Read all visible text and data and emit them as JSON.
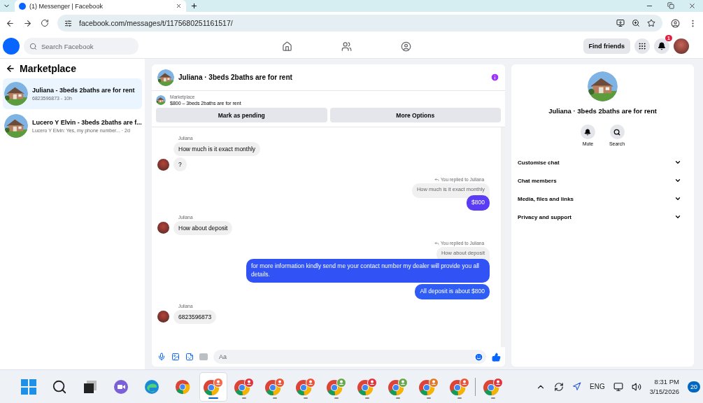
{
  "browser": {
    "tab_title": "(1) Messenger | Facebook",
    "url": "facebook.com/messages/t/1175680251161517/"
  },
  "topbar": {
    "search_placeholder": "Search Facebook",
    "find_friends": "Find friends",
    "notification_count": "1"
  },
  "sidebar": {
    "title": "Marketplace",
    "conversations": [
      {
        "name": "Juliana - 3beds 2baths are for rent",
        "preview": "6823596873 - 10h",
        "selected": true
      },
      {
        "name": "Lucero Y Elvin - 3beds 2baths are f...",
        "preview": "Lucero Y Elvin: Yes, my phone number... · 2d",
        "selected": false
      }
    ]
  },
  "chat": {
    "title": "Juliana · 3beds 2baths are for rent",
    "listing": {
      "label": "Marketplace",
      "title": "$800 – 3beds 2baths are for rent"
    },
    "buttons": [
      "Mark as pending",
      "More Options"
    ],
    "messages": [
      {
        "kind": "sender",
        "text": "Juliana"
      },
      {
        "kind": "incoming",
        "text": "How much is it exact monthly",
        "avatar": false
      },
      {
        "kind": "incoming",
        "text": "?",
        "avatar": true
      },
      {
        "kind": "reply_note",
        "text": "You replied to Juliana"
      },
      {
        "kind": "quoted",
        "text": "How much is it exact monthly"
      },
      {
        "kind": "outgoing",
        "text": "$800",
        "color": "#5b3cf5"
      },
      {
        "kind": "sender",
        "text": "Juliana"
      },
      {
        "kind": "incoming",
        "text": "How about deposit",
        "avatar": true
      },
      {
        "kind": "reply_note",
        "text": "You replied to Juliana"
      },
      {
        "kind": "quoted",
        "text": "How about deposit"
      },
      {
        "kind": "outgoing",
        "text": "for more information kindly send me your contact number my dealer will provide you all  details.",
        "color": "#3153f5"
      },
      {
        "kind": "outgoing",
        "text": "All deposit is about $800",
        "color": "#2f5cf5"
      },
      {
        "kind": "sender",
        "text": "Juliana"
      },
      {
        "kind": "incoming",
        "text": "6823596873",
        "avatar": true
      }
    ],
    "composer_placeholder": "Aa"
  },
  "details": {
    "title": "Juliana · 3beds 2baths are for rent",
    "actions": [
      {
        "kind": "mute",
        "label": "Mute"
      },
      {
        "kind": "search",
        "label": "Search"
      }
    ],
    "sections": [
      "Customise chat",
      "Chat members",
      "Media, files and links",
      "Privacy and support"
    ]
  },
  "taskbar": {
    "apps": [
      {
        "kind": "start",
        "active": false
      },
      {
        "kind": "search",
        "active": false
      },
      {
        "kind": "taskview",
        "active": false
      },
      {
        "kind": "meet",
        "active": false
      },
      {
        "kind": "edge",
        "active": false
      },
      {
        "kind": "chrome",
        "active": false
      },
      {
        "kind": "profile",
        "active": true,
        "color": "#f26b4a"
      },
      {
        "kind": "profile",
        "active": false,
        "color": "#e0343e"
      },
      {
        "kind": "profile",
        "active": false,
        "color": "#e8553a"
      },
      {
        "kind": "profile",
        "active": false,
        "color": "#e8553a"
      },
      {
        "kind": "profile",
        "active": false,
        "color": "#6aa84f"
      },
      {
        "kind": "profile",
        "active": false,
        "color": "#e0343e"
      },
      {
        "kind": "profile",
        "active": false,
        "color": "#6aa84f"
      },
      {
        "kind": "profile",
        "active": false,
        "color": "#e07b2e"
      },
      {
        "kind": "profile",
        "active": false,
        "color": "#e8553a"
      },
      {
        "kind": "separator"
      },
      {
        "kind": "profile",
        "active": false,
        "color": "#e0343e"
      }
    ],
    "language": "ENG",
    "time": "8:31 PM",
    "date": "3/15/2026",
    "notification_count": "20"
  }
}
